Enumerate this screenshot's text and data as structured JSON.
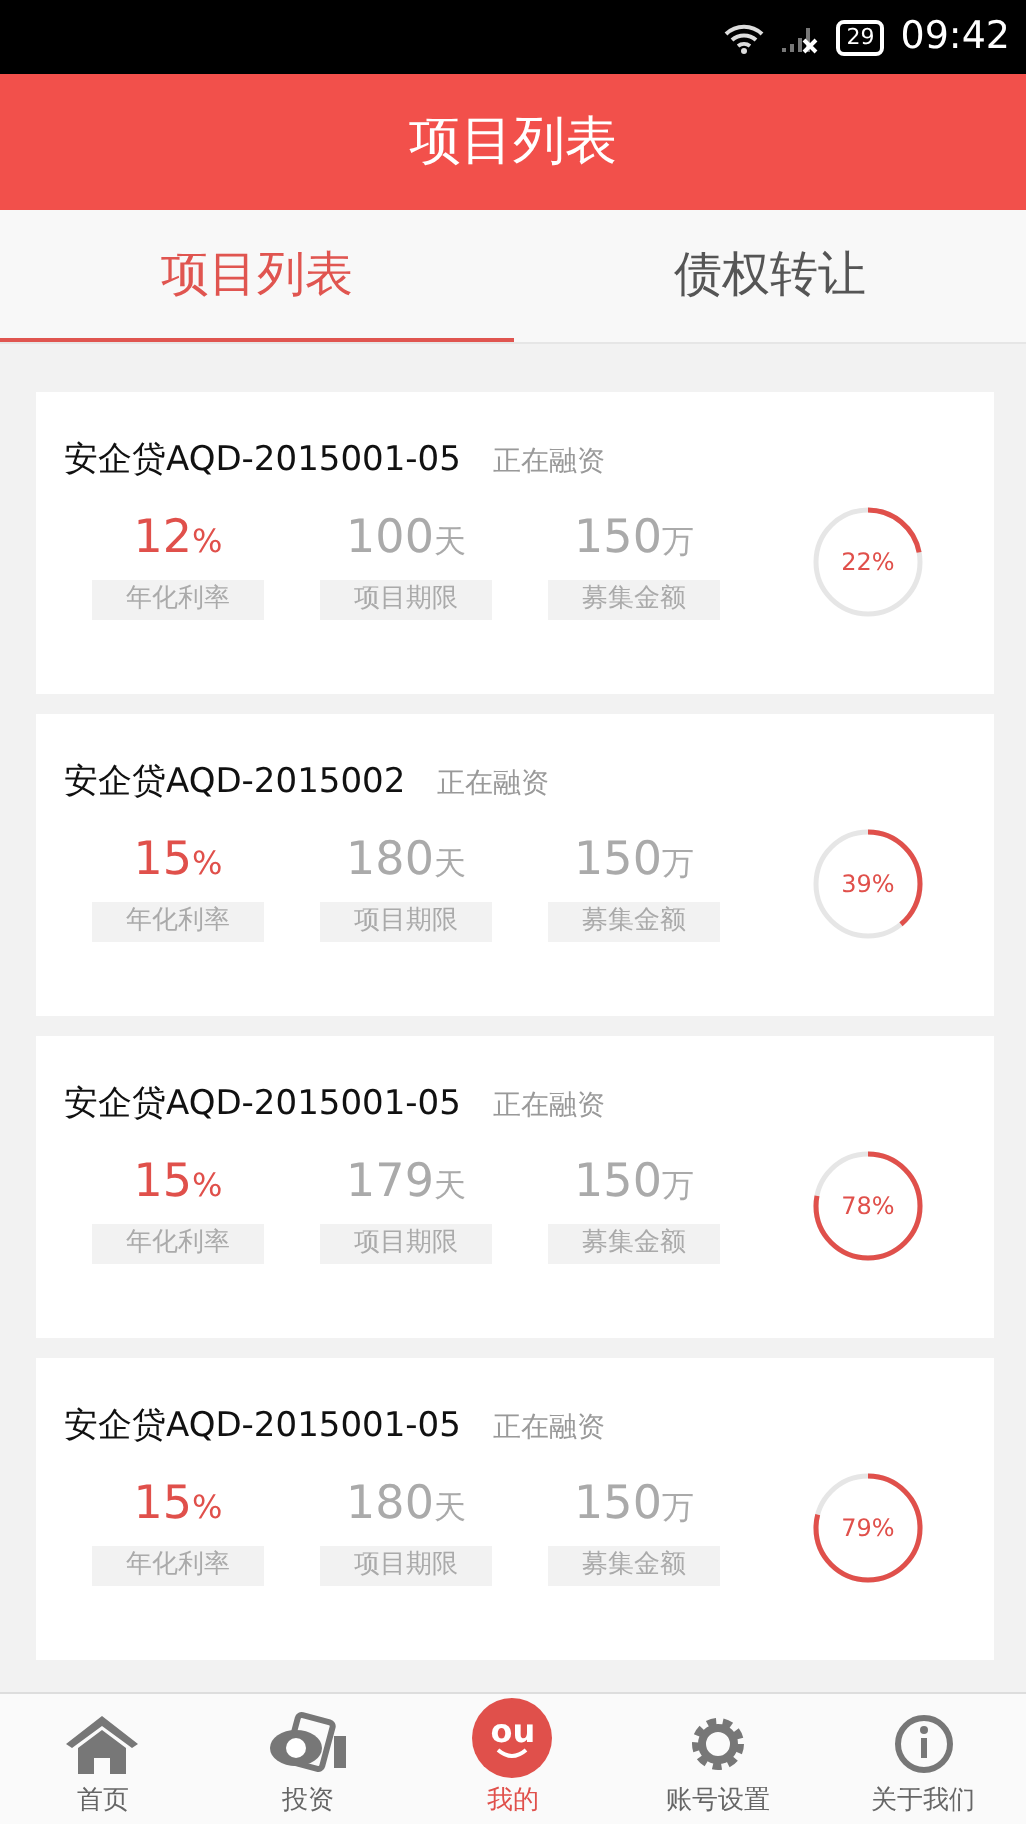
{
  "status_bar": {
    "battery": "29",
    "time": "09:42"
  },
  "header": {
    "title": "项目列表"
  },
  "tabs": [
    {
      "label": "项目列表",
      "selected": true
    },
    {
      "label": "债权转让",
      "selected": false
    }
  ],
  "projects": [
    {
      "name": "安企贷AQD-2015001-05",
      "status": "正在融资",
      "stats": [
        {
          "value": "12",
          "unit": "%",
          "label": "年化利率"
        },
        {
          "value": "100",
          "unit": "天",
          "label": "项目期限"
        },
        {
          "value": "150",
          "unit": "万",
          "label": "募集金额"
        }
      ],
      "progress": "22%",
      "level": 0.22
    },
    {
      "name": "安企贷AQD-2015002",
      "status": "正在融资",
      "stats": [
        {
          "value": "15",
          "unit": "%",
          "label": "年化利率"
        },
        {
          "value": "180",
          "unit": "天",
          "label": "项目期限"
        },
        {
          "value": "150",
          "unit": "万",
          "label": "募集金额"
        }
      ],
      "progress": "39%",
      "level": 0.39
    },
    {
      "name": "安企贷AQD-2015001-05",
      "status": "正在融资",
      "stats": [
        {
          "value": "15",
          "unit": "%",
          "label": "年化利率"
        },
        {
          "value": "179",
          "unit": "天",
          "label": "项目期限"
        },
        {
          "value": "150",
          "unit": "万",
          "label": "募集金额"
        }
      ],
      "progress": "78%",
      "level": 0.78
    },
    {
      "name": "安企贷AQD-2015001-05",
      "status": "正在融资",
      "stats": [
        {
          "value": "15",
          "unit": "%",
          "label": "年化利率"
        },
        {
          "value": "180",
          "unit": "天",
          "label": "项目期限"
        },
        {
          "value": "150",
          "unit": "万",
          "label": "募集金额"
        }
      ],
      "progress": "79%",
      "level": 0.79
    }
  ],
  "bottom_nav": [
    {
      "label": "首页",
      "kind": "home",
      "selected": false
    },
    {
      "label": "投资",
      "kind": "invest",
      "selected": false
    },
    {
      "label": "我的",
      "kind": "logo",
      "logo_text": "ou",
      "selected": true
    },
    {
      "label": "账号设置",
      "kind": "gear",
      "selected": false
    },
    {
      "label": "关于我们",
      "kind": "info",
      "selected": false
    }
  ]
}
